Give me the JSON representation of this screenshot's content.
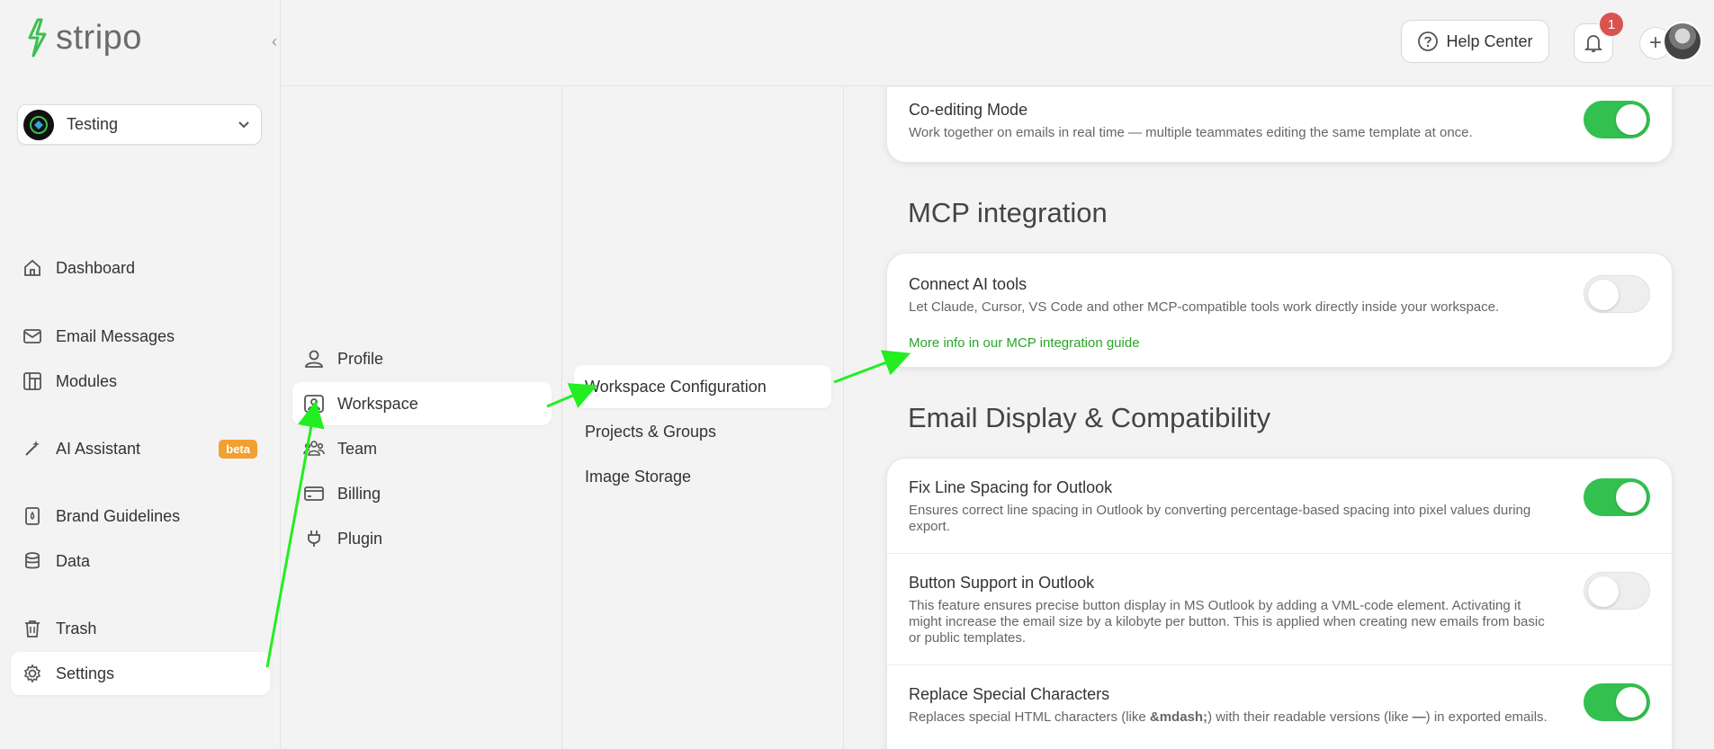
{
  "brand": {
    "name": "stripo"
  },
  "project": {
    "name": "Testing"
  },
  "sidebar": {
    "items": [
      {
        "label": "Dashboard",
        "icon": "home-icon"
      },
      {
        "label": "Email Messages",
        "icon": "mail-icon"
      },
      {
        "label": "Modules",
        "icon": "modules-icon"
      },
      {
        "label": "AI Assistant",
        "icon": "magic-wand-icon",
        "badge": "beta"
      },
      {
        "label": "Brand Guidelines",
        "icon": "brand-book-icon"
      },
      {
        "label": "Data",
        "icon": "database-icon"
      },
      {
        "label": "Trash",
        "icon": "trash-icon"
      },
      {
        "label": "Settings",
        "icon": "gear-icon",
        "active": true
      }
    ]
  },
  "header": {
    "help_label": "Help Center",
    "notification_count": "1"
  },
  "settings_menu": {
    "items": [
      {
        "label": "Profile"
      },
      {
        "label": "Workspace",
        "active": true
      },
      {
        "label": "Team"
      },
      {
        "label": "Billing"
      },
      {
        "label": "Plugin"
      }
    ]
  },
  "workspace_menu": {
    "items": [
      {
        "label": "Workspace Configuration",
        "active": true
      },
      {
        "label": "Projects & Groups"
      },
      {
        "label": "Image Storage"
      }
    ]
  },
  "main": {
    "coediting": {
      "title": "Co-editing Mode",
      "desc": "Work together on emails in real time — multiple teammates editing the same template at once.",
      "enabled": true
    },
    "mcp": {
      "section_title": "MCP integration",
      "title": "Connect AI tools",
      "desc": "Let Claude, Cursor, VS Code and other MCP-compatible tools work directly inside your workspace.",
      "link": "More info in our MCP integration guide",
      "enabled": false
    },
    "compat": {
      "section_title": "Email Display & Compatibility",
      "rows": [
        {
          "title": "Fix Line Spacing for Outlook",
          "desc": "Ensures correct line spacing in Outlook by converting percentage-based spacing into pixel values during export.",
          "enabled": true
        },
        {
          "title": "Button Support in Outlook",
          "desc": "This feature ensures precise button display in MS Outlook by adding a VML-code element. Activating it might increase the email size by a kilobyte per button. This is applied when creating new emails from basic or public templates.",
          "enabled": false
        },
        {
          "title": "Replace Special Characters",
          "desc_prefix": "Replaces special HTML characters (like ",
          "desc_code": "&mdash;",
          "desc_middle": ") with their readable versions (like ",
          "desc_code2": "—",
          "desc_suffix": ") in exported emails.",
          "enabled": true
        }
      ]
    }
  },
  "colors": {
    "accent_green": "#33c04f",
    "link_green": "#2aa52a",
    "beta_orange": "#f0a131",
    "badge_red": "#d9534f",
    "annotation_arrow": "#22ee22"
  }
}
